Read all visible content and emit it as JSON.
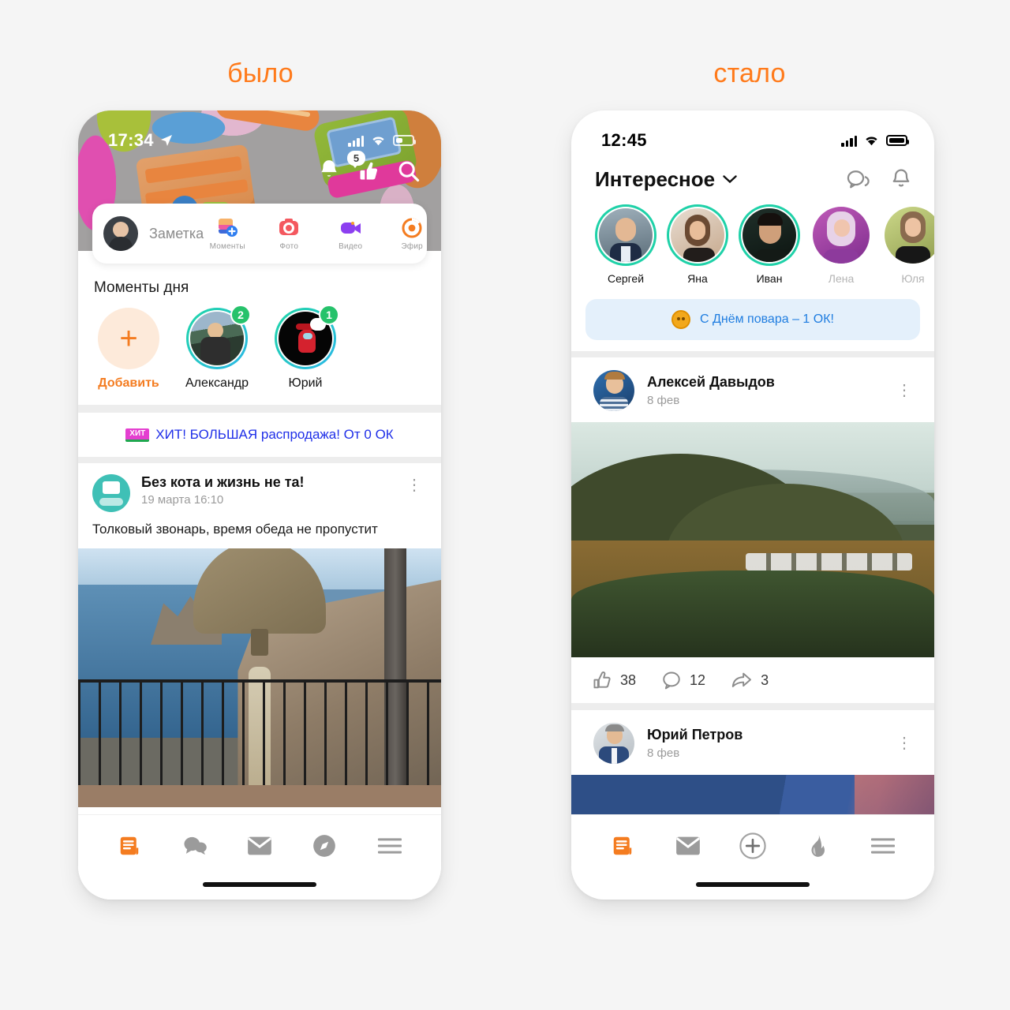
{
  "captions": {
    "before": "было",
    "after": "стало"
  },
  "accent": "#ff7a1a",
  "left_phone": {
    "status": {
      "time": "17:34",
      "location_icon": "location-arrow-icon"
    },
    "header_icons": [
      "bell-icon",
      "like-icon",
      "search-icon"
    ],
    "like_badge": "5",
    "composer": {
      "placeholder": "Заметка",
      "actions": [
        {
          "label": "Моменты",
          "icon": "moments-icon"
        },
        {
          "label": "Фото",
          "icon": "photo-camera-icon"
        },
        {
          "label": "Видео",
          "icon": "video-camera-icon"
        },
        {
          "label": "Эфир",
          "icon": "live-broadcast-icon"
        }
      ]
    },
    "moments": {
      "title": "Моменты дня",
      "items": [
        {
          "name": "Добавить",
          "badge": "",
          "type": "add"
        },
        {
          "name": "Александр",
          "badge": "2",
          "type": "story"
        },
        {
          "name": "Юрий",
          "badge": "1",
          "type": "story"
        }
      ]
    },
    "ad": {
      "chip": "ХИТ",
      "text": "ХИТ! БОЛЬШАЯ распродажа! От 0 ОК"
    },
    "post": {
      "author": "Без кота и жизнь не та!",
      "date": "19 марта 16:10",
      "text": "Толковый звонарь, время обеда не пропустит",
      "menu_icon": "kebab-menu-icon"
    },
    "tabs": [
      {
        "icon": "feed-icon",
        "active": true
      },
      {
        "icon": "discussions-icon",
        "active": false
      },
      {
        "icon": "messages-icon",
        "active": false
      },
      {
        "icon": "compass-icon",
        "active": false
      },
      {
        "icon": "menu-icon",
        "active": false
      }
    ]
  },
  "right_phone": {
    "status": {
      "time": "12:45"
    },
    "header": {
      "title": "Интересное",
      "chevron": "chevron-down-icon",
      "icons": [
        "discussions-icon",
        "bell-icon"
      ]
    },
    "stories": [
      {
        "name": "Сергей",
        "unseen": true
      },
      {
        "name": "Яна",
        "unseen": true
      },
      {
        "name": "Иван",
        "unseen": true
      },
      {
        "name": "Лена",
        "unseen": false
      },
      {
        "name": "Юля",
        "unseen": false
      }
    ],
    "promo": {
      "icon": "ok-coin-icon",
      "text": "С Днём повара – 1 ОК!"
    },
    "posts": [
      {
        "author": "Алексей Давыдов",
        "date": "8 фев",
        "menu_icon": "kebab-menu-icon",
        "reactions": {
          "likes": "38",
          "comments": "12",
          "shares": "3"
        }
      },
      {
        "author": "Юрий Петров",
        "date": "8 фев",
        "menu_icon": "kebab-menu-icon"
      }
    ],
    "tabs": [
      {
        "icon": "feed-icon",
        "active": true
      },
      {
        "icon": "messages-icon",
        "active": false
      },
      {
        "icon": "add-post-icon",
        "active": false
      },
      {
        "icon": "flame-icon",
        "active": false
      },
      {
        "icon": "menu-icon",
        "active": false
      }
    ]
  }
}
